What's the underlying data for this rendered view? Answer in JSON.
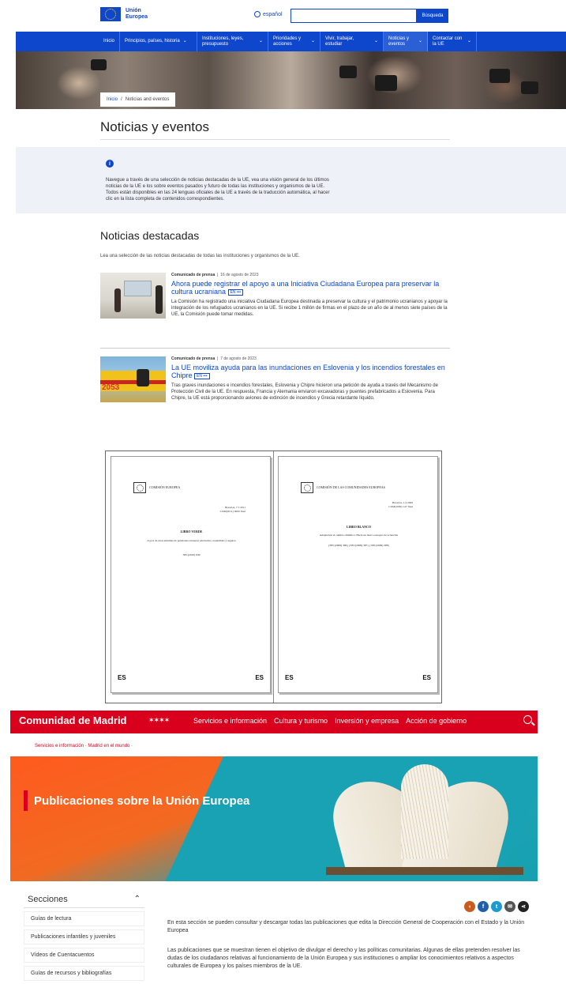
{
  "eu_header": {
    "logo_text_line1": "Unión",
    "logo_text_line2": "Europea",
    "language": "español",
    "search_button": "Búsqueda",
    "search_placeholder": ""
  },
  "eu_nav": {
    "items": [
      {
        "label": "Inicio"
      },
      {
        "label": "Principios, países, historia"
      },
      {
        "label": "Instituciones, leyes, presupuesto"
      },
      {
        "label": "Prioridades y acciones"
      },
      {
        "label": "Vivir, trabajar, estudiar"
      },
      {
        "label": "Noticias y eventos"
      },
      {
        "label": "Contactar con la UE"
      }
    ]
  },
  "eu_breadcrumb": {
    "home": "Inicio",
    "sep": "/",
    "current": "Noticias and eventos"
  },
  "eu_page": {
    "title": "Noticias y eventos",
    "info_text": "Navegue a través de una selección de noticias destacadas de la UE, vea una visión general de los últimos noticias de la UE e los sobre eventos pasados y futuro de todas las instituciones y organismos de la UE. Todos están disponibles en las 24 lenguas oficiales de la UE a través de la traducción automática, al hacer clic en la lista completa de contenidos correspondientes.",
    "featured_title": "Noticias destacadas",
    "featured_sub": "Lea una selección de las noticias destacadas de todas las instituciones y organismos de la UE."
  },
  "news": [
    {
      "type": "Comunicado de prensa",
      "date": "16 de agosto de 2023",
      "headline": "Ahora puede registrar el apoyo a una Iniciativa Ciudadana Europea para preservar la cultura ucraniana",
      "tag": "EN •••",
      "text": "La Comisión ha registrado una iniciativa Ciudadana Europea destinada a preservar la cultura y el patrimonio ucranianos y apoyar la integración de los refugiados ucranianos en la UE. Si recibe 1 millón de firmas en el plazo de un año de al menos siete países de la UE, la Comisión puede tomar medidas."
    },
    {
      "type": "Comunicado de prensa",
      "date": "7 de agosto de 2023",
      "headline": "La UE moviliza ayuda para las inundaciones en Eslovenia y los incendios forestales en Chipre",
      "tag": "EN •••",
      "text": "Tras graves inundaciones e incendios forestales, Eslovenia y Chipre hicieron una petición de ayuda a través del Mecanismo de Protección Civil de la UE. En respuesta, Francia y Alemania enviaron excavadoras y puentes prefabricados a Eslovenia. Para Chipre, la UE está proporcionando aviones de extinción de incendios y Grecia retardante líquido."
    }
  ],
  "documents": [
    {
      "org": "COMISIÓN EUROPEA",
      "date_line": "Bruselas, 7.7.2011",
      "ref_line": "COM(2011) 0000 final",
      "kind": "LIBRO VERDE",
      "subtitle": "en pos de unos sistemas de pensiones europeos adecuados, sostenibles y seguros",
      "extra": "SEC(2010) 830",
      "lang_left": "ES",
      "lang_right": "ES"
    },
    {
      "org": "COMISIÓN DE LAS COMUNIDADES EUROPEAS",
      "date_line": "Bruselas, 1.4.2009",
      "ref_line": "COM(2009) 147 final",
      "kind": "LIBRO BLANCO",
      "subtitle": "Adaptación al cambio climático: Hacia un marco europeo de actuación",
      "extra": "{SEC(2009) 386} {SEC(2009) 387} {SEC(2009) 388}",
      "lang_left": "ES",
      "lang_right": "ES"
    }
  ],
  "madrid_header": {
    "brand": "Comunidad de Madrid",
    "stars": "✶✶✶✶",
    "nav": [
      "Servicios e información",
      "Cultura y turismo",
      "Inversión y empresa",
      "Acción de gobierno"
    ]
  },
  "madrid_breadcrumb": "Servicios e información · Madrid en el mundo ·",
  "madrid_hero_title": "Publicaciones sobre la Unión Europea",
  "secciones": {
    "title": "Secciones",
    "toggle": "⌃",
    "items": [
      "Guías de lectura",
      "Publicaciones infantiles y juveniles",
      "Vídeos de Cuentacuentos",
      "Guías de recursos y bibliografías"
    ]
  },
  "social_icons": [
    {
      "name": "audio-icon",
      "glyph": "◖",
      "color": "#c95c1c"
    },
    {
      "name": "facebook-icon",
      "glyph": "f",
      "color": "#1f5faa"
    },
    {
      "name": "twitter-icon",
      "glyph": "t",
      "color": "#1d9bd1"
    },
    {
      "name": "email-icon",
      "glyph": "✉",
      "color": "#555555"
    },
    {
      "name": "share-icon",
      "glyph": "⋖",
      "color": "#222222"
    }
  ],
  "madrid_text": {
    "p1": "En esta sección se pueden consultar y descargar todas las publicaciones que edita la Dirección General de Cooperación con el Estado y la Unión Europea",
    "p2": "Las publicaciones que se muestran tienen el objetivo de divulgar el derecho y las políticas comunitarias. Algunas de ellas pretenden resolver las dudas de los ciudadanos relativas al funcionamiento de la Unión Europea y sus instituciones o ampliar los conocimientos relativos a aspectos culturales de Europea y los países miembros de la UE."
  },
  "colors": {
    "eu_blue": "#0e47cb",
    "madrid_red": "#d8001c",
    "hero_orange": "#f26a21",
    "hero_teal": "#19a2b3"
  }
}
